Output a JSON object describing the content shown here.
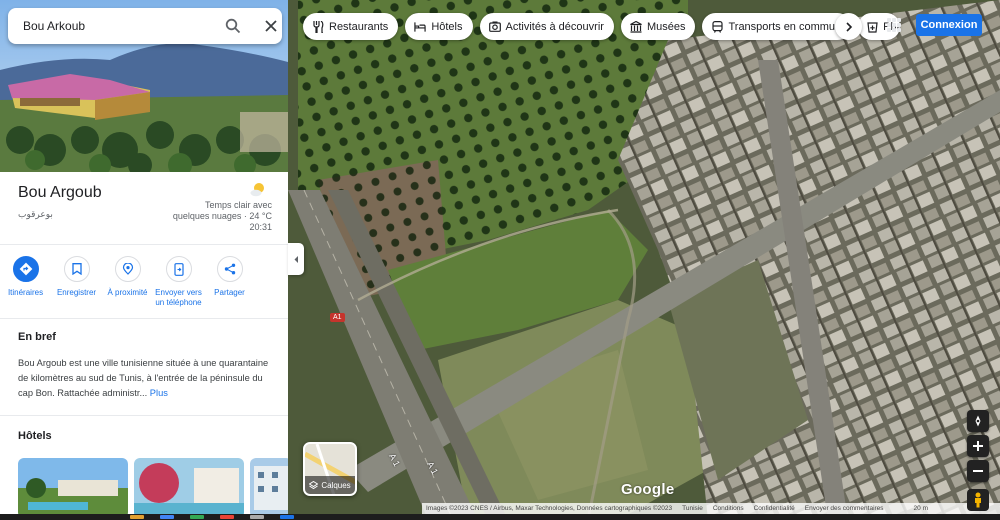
{
  "search": {
    "value": "Bou Arkoub"
  },
  "place": {
    "name": "Bou Argoub",
    "native_name": "بوعرقوب",
    "weather_line1": "Temps clair avec",
    "weather_line2": "quelques nuages · 24 °C",
    "weather_time": "20:31"
  },
  "actions": [
    {
      "label": "Itinéraires",
      "icon": "directions-icon"
    },
    {
      "label": "Enregistrer",
      "icon": "bookmark-icon"
    },
    {
      "label": "À proximité",
      "icon": "nearby-icon"
    },
    {
      "label": "Envoyer vers un téléphone",
      "icon": "send-to-phone-icon"
    },
    {
      "label": "Partager",
      "icon": "share-icon"
    }
  ],
  "about": {
    "title": "En bref",
    "text": "Bou Argoub est une ville tunisienne située à une quarantaine de kilomètres au sud de Tunis, à l'entrée de la péninsule du cap Bon. Rattachée administr...",
    "more": "Plus"
  },
  "hotels": {
    "title": "Hôtels"
  },
  "chips": [
    {
      "label": "Restaurants",
      "icon": "restaurant-icon"
    },
    {
      "label": "Hôtels",
      "icon": "hotel-icon"
    },
    {
      "label": "Activités à découvrir",
      "icon": "camera-icon"
    },
    {
      "label": "Musées",
      "icon": "museum-icon"
    },
    {
      "label": "Transports en commun",
      "icon": "transit-icon"
    },
    {
      "label": "Phar",
      "icon": "pharmacy-icon"
    }
  ],
  "login": "Connexion",
  "layers_label": "Calques",
  "google": "Google",
  "attribution": {
    "imagery": "Images ©2023 CNES / Airbus, Maxar Technologies, Données cartographiques ©2023",
    "tunisia": "Tunisie",
    "terms": "Conditions",
    "privacy": "Confidentialité",
    "feedback": "Envoyer des commentaires",
    "scale": "20 m"
  },
  "road": {
    "shield": "A1",
    "label1": "A 1",
    "label2": "A 1"
  },
  "colors": {
    "accent": "#1a73e8",
    "login": "#1a73e8"
  }
}
